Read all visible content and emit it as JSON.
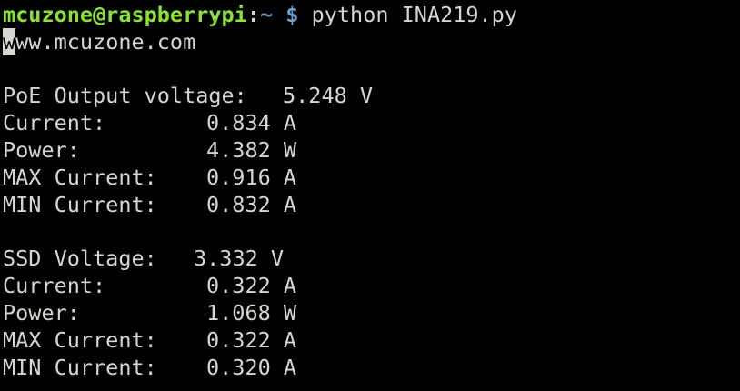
{
  "prompt": {
    "user_host": "mcuzone@raspberrypi",
    "separator": ":",
    "cwd": "~",
    "symbol": "$",
    "command": "python INA219.py"
  },
  "banner": {
    "cursor_char": "w",
    "rest": "ww.mcuzone.com"
  },
  "poe": {
    "voltage_label": "PoE Output voltage:",
    "voltage_value": "5.248 V",
    "current_label": "Current:",
    "current_value": "0.834 A",
    "power_label": "Power:",
    "power_value": "4.382 W",
    "max_label": "MAX Current:",
    "max_value": "0.916 A",
    "min_label": "MIN Current:",
    "min_value": "0.832 A"
  },
  "ssd": {
    "voltage_label": "SSD Voltage:",
    "voltage_value": "3.332 V",
    "current_label": "Current:",
    "current_value": "0.322 A",
    "power_label": "Power:",
    "power_value": "1.068 W",
    "max_label": "MAX Current:",
    "max_value": "0.322 A",
    "min_label": "MIN Current:",
    "min_value": "0.320 A"
  },
  "colors": {
    "background": "#000000",
    "text": "#d3d7cf",
    "user_host": "#8ae234",
    "path": "#729fcf"
  }
}
